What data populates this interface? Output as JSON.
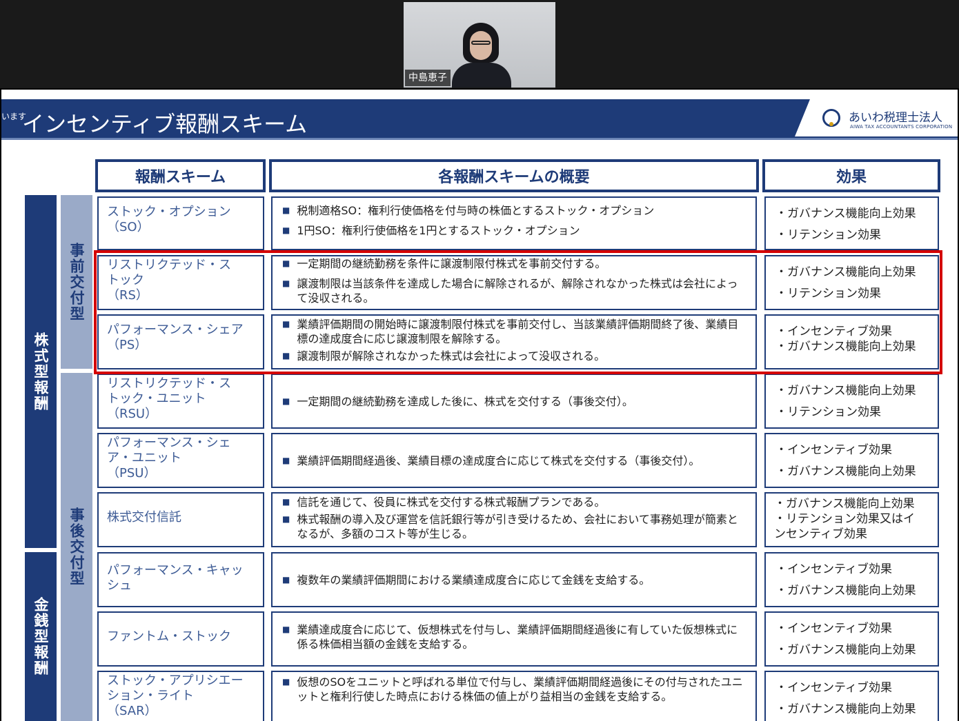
{
  "participant": {
    "name": "中島恵子"
  },
  "slide": {
    "pre_text": "います",
    "title": "インセンティブ報酬スキーム",
    "logo_jp": "あいわ税理士法人",
    "logo_en": "AIWA TAX ACCOUNTANTS CORPORATION",
    "headers": {
      "scheme": "報酬スキーム",
      "overview": "各報酬スキームの概要",
      "effect": "効果"
    },
    "categories": {
      "stock": "株式型報酬",
      "cash": "金銭型報酬"
    },
    "subcategories": {
      "advance": "事前交付型",
      "post": "事後交付型"
    },
    "rows": [
      {
        "name": [
          "ストック・オプション",
          "（SO）"
        ],
        "desc": [
          "税制適格SO：権利行使価格を付与時の株価とするストック・オプション",
          "1円SO：権利行使価格を1円とするストック・オプション"
        ],
        "effects": [
          "・ガバナンス機能向上効果",
          "・リテンション効果"
        ]
      },
      {
        "name": [
          "リストリクテッド・ス",
          "トック",
          "（RS）"
        ],
        "desc": [
          "一定期間の継続勤務を条件に譲渡制限付株式を事前交付する。",
          "譲渡制限は当該条件を達成した場合に解除されるが、解除されなかった株式は会社によって没収される。"
        ],
        "effects": [
          "・ガバナンス機能向上効果",
          "・リテンション効果"
        ]
      },
      {
        "name": [
          "パフォーマンス・シェア",
          "（PS）"
        ],
        "desc": [
          "業績評価期間の開始時に譲渡制限付株式を事前交付し、当該業績評価期間終了後、業績目標の達成度合に応じ譲渡制限を解除する。",
          "譲渡制限が解除されなかった株式は会社によって没収される。"
        ],
        "effects": [
          "・インセンティブ効果",
          "・ガバナンス機能向上効果"
        ]
      },
      {
        "name": [
          "リストリクテッド・ス",
          "トック・ユニット",
          "（RSU）"
        ],
        "desc": [
          "一定期間の継続勤務を達成した後に、株式を交付する（事後交付）。"
        ],
        "effects": [
          "・ガバナンス機能向上効果",
          "・リテンション効果"
        ]
      },
      {
        "name": [
          "パフォーマンス・シェ",
          "ア・ユニット",
          "（PSU）"
        ],
        "desc": [
          "業績評価期間経過後、業績目標の達成度合に応じて株式を交付する（事後交付）。"
        ],
        "effects": [
          "・インセンティブ効果",
          "・ガバナンス機能向上効果"
        ]
      },
      {
        "name": [
          "株式交付信託"
        ],
        "desc": [
          "信託を通じて、役員に株式を交付する株式報酬プランである。",
          "株式報酬の導入及び運営を信託銀行等が引き受けるため、会社において事務処理が簡素となるが、多額のコスト等が生じる。"
        ],
        "effects": [
          "・ガバナンス機能向上効果",
          "・リテンション効果又はイ",
          "ンセンティブ効果"
        ]
      },
      {
        "name": [
          "パフォーマンス・キャッ",
          "シュ"
        ],
        "desc": [
          "複数年の業績評価期間における業績達成度合に応じて金銭を支給する。"
        ],
        "effects": [
          "・インセンティブ効果",
          "・ガバナンス機能向上効果"
        ]
      },
      {
        "name": [
          "ファントム・ストック"
        ],
        "desc": [
          "業績達成度合に応じて、仮想株式を付与し、業績評価期間経過後に有していた仮想株式に係る株価相当額の金銭を支給する。"
        ],
        "effects": [
          "・インセンティブ効果",
          "・ガバナンス機能向上効果"
        ]
      },
      {
        "name": [
          "ストック・アプリシエー",
          "ション・ライト",
          "（SAR）"
        ],
        "desc": [
          "仮想のSOをユニットと呼ばれる単位で付与し、業績評価期間経過後にその付与されたユニットと権利行使した時点における株価の値上がり益相当の金銭を支給する。"
        ],
        "effects": [
          "・インセンティブ効果",
          "・ガバナンス機能向上効果"
        ]
      }
    ]
  }
}
